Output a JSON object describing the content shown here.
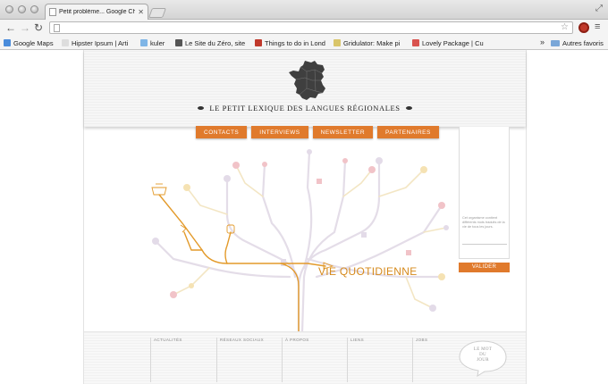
{
  "browser": {
    "tab_title": "Petit problème... Google Ch",
    "url": "",
    "bookmarks": [
      {
        "label": "Google Maps",
        "color": "#4a8cdb"
      },
      {
        "label": "Hipster Ipsum | Arti",
        "color": "#dddddd"
      },
      {
        "label": "kuler",
        "color": "#7fb5e6"
      },
      {
        "label": "Le Site du Zéro, site",
        "color": "#555555"
      },
      {
        "label": "Things to do in Lond",
        "color": "#c0392b"
      },
      {
        "label": "Gridulator: Make pi",
        "color": "#d9c56a"
      },
      {
        "label": "Lovely Package | Cu",
        "color": "#d9534f"
      }
    ],
    "bookmarks_more": "»",
    "other_bookmarks": "Autres favoris"
  },
  "site": {
    "title": "LE PETIT LEXIQUE DES LANGUES RÉGIONALES",
    "nav": [
      "CONTACTS",
      "INTERVIEWS",
      "NEWSLETTER",
      "PARTENAIRES"
    ],
    "sidebar_hint": "Cet organisme contient différents mots traduits de la vie de tous les jours.",
    "submit_label": "VALIDER",
    "category": "VIE QUOTIDIENNE",
    "footer_columns": [
      "ACTUALITÉS",
      "RÉSEAUX SOCIAUX",
      "À PROPOS",
      "LIENS",
      "JOBS"
    ],
    "mot_du_jour": [
      "LE MOT",
      "DU",
      "JOUR"
    ],
    "accent_color": "#e07a2c"
  }
}
